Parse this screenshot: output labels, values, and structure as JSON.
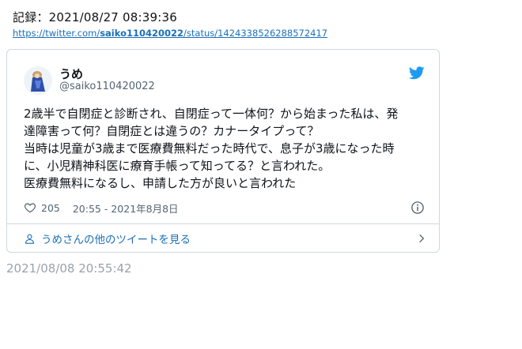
{
  "record_label": "記録：2021/08/27 08:39:36",
  "source_url": {
    "prefix": "https://twitter.com/",
    "user": "saiko110420022",
    "suffix": "/status/1424338526288572417"
  },
  "tweet": {
    "display_name": "うめ",
    "handle": "@saiko110420022",
    "lines": [
      "2歳半で自閉症と診断され、自閉症って一体何？から始まった私は、発",
      "達障害って何？自閉症とは違うの？カナータイプって？",
      "当時は児童が3歳まで医療費無料だった時代で、息子が3歳になった時",
      "に、小児精神科医に療育手帳って知ってる？と言われた。",
      "医療費無料になるし、申請した方が良いと言われた"
    ],
    "like_count": "205",
    "timestamp": "20:55 - 2021年8月8日",
    "more_tweets_label": "うめさんの他のツイートを見る"
  },
  "posted_at": "2021/08/08 20:55:42",
  "colors": {
    "link": "#1b6fb8",
    "twitter_blue": "#1d9bf0",
    "muted": "#536471",
    "border": "#cfd9de"
  },
  "icons": [
    "twitter-bird-icon",
    "heart-icon",
    "info-icon",
    "person-icon",
    "chevron-right-icon"
  ]
}
